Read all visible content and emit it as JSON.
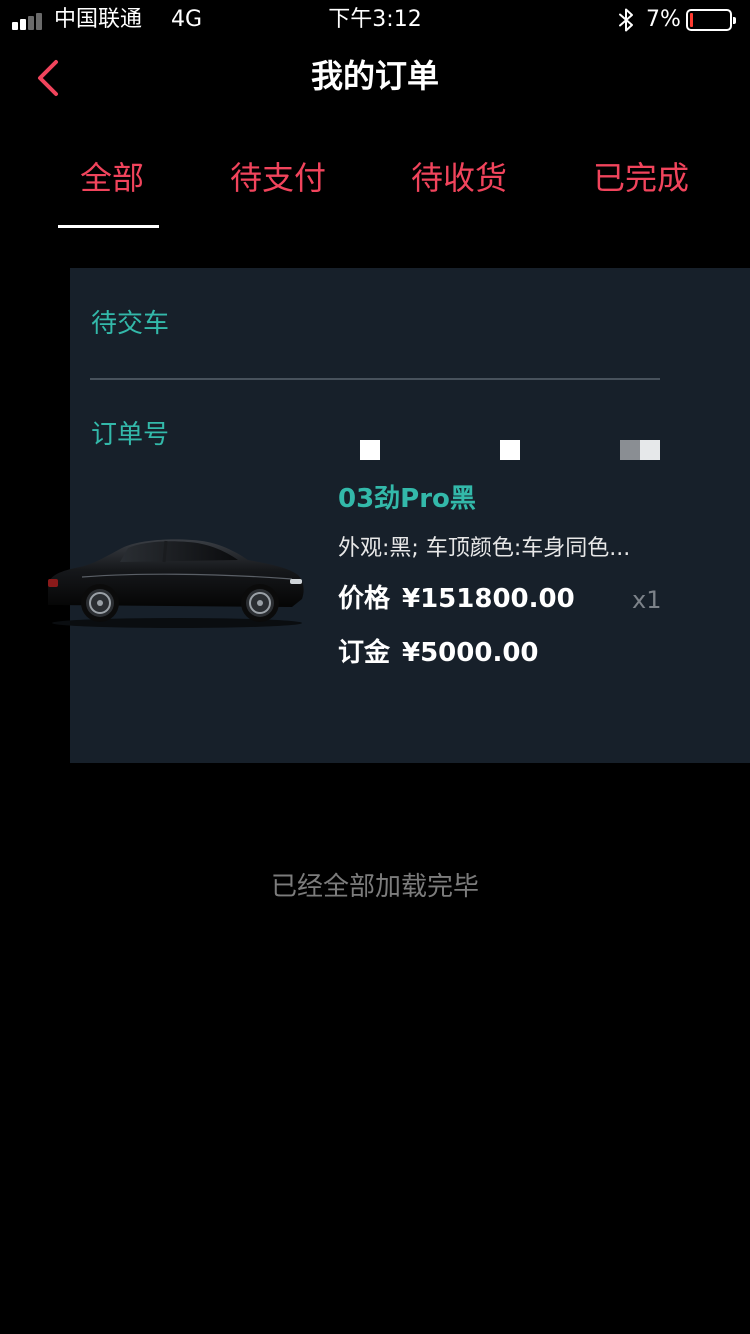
{
  "status_bar": {
    "carrier": "中国联通",
    "network": "4G",
    "time": "下午3:12",
    "battery_percent": "7%",
    "battery_level": 0.07,
    "icons": [
      "signal-icon",
      "bluetooth-icon",
      "battery-icon"
    ]
  },
  "nav": {
    "title": "我的订单",
    "back_icon": "chevron-left-icon"
  },
  "tabs": [
    {
      "label": "全部",
      "active": true
    },
    {
      "label": "待支付",
      "active": false
    },
    {
      "label": "待收货",
      "active": false
    },
    {
      "label": "已完成",
      "active": false
    }
  ],
  "order": {
    "status": "待交车",
    "order_no_label": "订单号",
    "product_name": "03劲Pro黑",
    "spec": "外观:黑; 车顶颜色:车身同色...",
    "price_label": "价格",
    "price": "¥151800.00",
    "quantity": "x1",
    "deposit_label": "订金",
    "deposit": "¥5000.00"
  },
  "footer": {
    "end_text": "已经全部加载完毕"
  },
  "colors": {
    "accent": "#f1445c",
    "teal": "#33b9aa",
    "card_bg": "#17202a",
    "background": "#000000"
  }
}
